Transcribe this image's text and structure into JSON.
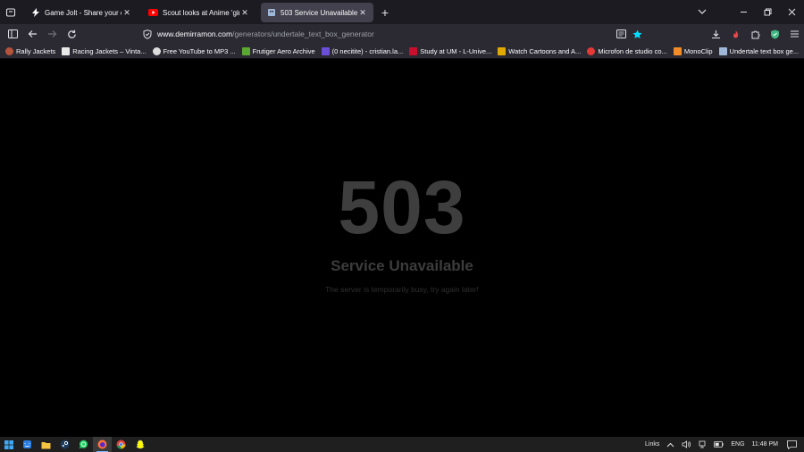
{
  "tabs": [
    {
      "title": "Game Jolt - Share your creation",
      "icon": "gamejolt-icon",
      "active": false
    },
    {
      "title": "Scout looks at Anime 'girls' on T",
      "icon": "youtube-icon",
      "active": false
    },
    {
      "title": "503 Service Unavailable",
      "icon": "undertale-icon",
      "active": true
    }
  ],
  "new_tab": "+",
  "url": {
    "host": "www.demirramon.com",
    "path": "/generators/undertale_text_box_generator"
  },
  "bookmarks": [
    {
      "label": "Rally Jackets",
      "color": "#b5533b"
    },
    {
      "label": "Racing Jackets – Vinta...",
      "color": "#e8e8e8"
    },
    {
      "label": "Free YouTube to MP3 ...",
      "color": "#dddddd"
    },
    {
      "label": "Frutiger Aero Archive",
      "color": "#5aa832"
    },
    {
      "label": "(0 necitite) - cristian.la...",
      "color": "#6b4fd8"
    },
    {
      "label": "Study at UM - L-Unive...",
      "color": "#c8102e"
    },
    {
      "label": "Watch Cartoons and A...",
      "color": "#e0a800"
    },
    {
      "label": "Microfon de studio co...",
      "color": "#e53935"
    },
    {
      "label": "MonoClip",
      "color": "#f28c28"
    },
    {
      "label": "Undertale text box ge...",
      "color": "#9fb7d8"
    }
  ],
  "error": {
    "code": "503",
    "title": "Service Unavailable",
    "message": "The server is temporarily busy, try again later!"
  },
  "taskbar": {
    "apps": [
      "windows-start-icon",
      "finder-icon",
      "file-explorer-icon",
      "steam-icon",
      "whatsapp-icon",
      "firefox-icon",
      "chrome-icon",
      "snapchat-icon"
    ],
    "links_label": "Links",
    "language": "ENG",
    "time": "11:48 PM"
  },
  "colors": {
    "tabstrip": "#1c1b22",
    "toolbar": "#2b2a33",
    "active_tab": "#42414d",
    "page_bg": "#000000",
    "error_text": "#3e3e3e"
  }
}
